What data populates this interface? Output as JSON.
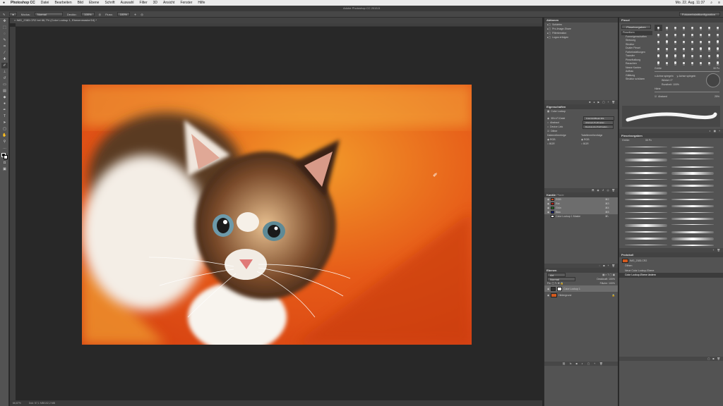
{
  "menubar": {
    "apple": "",
    "app": "Photoshop CC",
    "items": [
      "Datei",
      "Bearbeiten",
      "Bild",
      "Ebene",
      "Schrift",
      "Auswahl",
      "Filter",
      "3D",
      "Ansicht",
      "Fenster",
      "Hilfe"
    ],
    "clock": "Mo. 22. Aug. 11:37"
  },
  "window_title": "Adobe Photoshop CC 2015.5",
  "options": {
    "mode_label": "Modus:",
    "mode_value": "Normal",
    "opacity_label": "Deckkr.:",
    "opacity_value": "100%",
    "flow_label": "Fluss:",
    "flow_value": "100%",
    "workspace": "Fotowerkstattkonfiguration"
  },
  "document": {
    "tab": "IMG_2383.CR2 bei 66,7% (Color Lookup 1, Ebenenmaske/16) *",
    "status_zoom": "66,67%",
    "status_info": "Dok: 57,1 MB/102,2 MB"
  },
  "history_panel": {
    "title": "Aktionen",
    "items": [
      "Schärfen",
      "Pro-Image-Share",
      "Filterkreation",
      "Logos erfolgen"
    ]
  },
  "properties_panel": {
    "title": "Eigenschaften",
    "subtitle": "Color Lookup",
    "rows": [
      {
        "label": "3DLUT-Datei",
        "value": "FuturisticBleak.3DL"
      },
      {
        "label": "Abstract",
        "value": "Abstract-Profil laden..."
      },
      {
        "label": "Device Link",
        "value": "DeviceLink-Profil laden..."
      },
      {
        "label": "Dither",
        "value": ""
      }
    ],
    "data_order_label": "Datenreihenfolge",
    "table_order_label": "Tabellenreihenfolge",
    "rgb": "RGB",
    "bgr": "BGR"
  },
  "channels_panel": {
    "tabs": [
      "Kanäle",
      "Pfade"
    ],
    "items": [
      {
        "name": "RGB",
        "shortcut": "⌘2",
        "color": "#c84a1e"
      },
      {
        "name": "Rot",
        "shortcut": "⌘3",
        "color": "#b81c10"
      },
      {
        "name": "Grün",
        "shortcut": "⌘4",
        "color": "#1e6e1e"
      },
      {
        "name": "Blau",
        "shortcut": "⌘5",
        "color": "#101c70"
      },
      {
        "name": "Color Lookup 1 Maske",
        "shortcut": "⌘\\",
        "color": "#ffffff"
      }
    ]
  },
  "layers_panel": {
    "title": "Ebenen",
    "filter": "Art",
    "blend": "Normal",
    "opacity_label": "Deckkraft: 100%",
    "fill_label": "Fläche: 100%",
    "items": [
      {
        "name": "Color Lookup 1",
        "selected": true
      },
      {
        "name": "Hintergrund",
        "selected": false
      }
    ]
  },
  "brush_panel": {
    "title": "Pinsel",
    "presets_button": "Pinselvorgaben",
    "sizes": [
      "30",
      "30",
      "30",
      "25",
      "25",
      "36",
      "25",
      "25",
      "36",
      "36",
      "32",
      "25",
      "14",
      "24",
      "27",
      "39",
      "46",
      "59",
      "11",
      "17",
      "23",
      "36",
      "44",
      "60",
      "14",
      "26",
      "33",
      "42",
      "55",
      "70",
      "112",
      "134",
      "74",
      "95",
      "95",
      "90",
      "36",
      "36",
      "33",
      "63",
      "66",
      "39",
      "63",
      "11",
      "48",
      "32",
      "55",
      "100"
    ],
    "options": [
      "Pinselform",
      "Formeigenschaften",
      "Streuung",
      "Struktur",
      "Dualer Pinsel",
      "Farbeinstellungen",
      "Transfer",
      "Pinselhaltung",
      "Rauschen",
      "Nasse Kanten",
      "Aufbau",
      "Glättung",
      "Struktur schützen"
    ],
    "size_label": "Größe",
    "size_value": "30 Px",
    "flip_x": "x-Achse spiegeln",
    "flip_y": "y-Achse spiegeln",
    "angle": "Winkel: 0°",
    "roundness": "Rundheit: 100%",
    "hardness": "Härte",
    "spacing": "Abstand",
    "spacing_value": "25%"
  },
  "brush_presets": {
    "title": "Pinselvorgaben",
    "size_label": "Größe:",
    "size_value": "30 Px"
  },
  "history_list": {
    "title": "Protokoll",
    "snapshot": "IMG_2383.CR2",
    "items": [
      "Öffnen",
      "Neue Color Lookup-Ebene",
      "Color Lookup-Ebene ändern"
    ]
  },
  "tools": [
    "move-icon",
    "marquee-icon",
    "lasso-icon",
    "quick-select-icon",
    "crop-icon",
    "eyedropper-icon",
    "healing-icon",
    "brush-icon",
    "stamp-icon",
    "history-brush-icon",
    "eraser-icon",
    "gradient-icon",
    "blur-icon",
    "dodge-icon",
    "pen-icon",
    "type-icon",
    "path-select-icon",
    "shape-icon",
    "hand-icon",
    "zoom-icon"
  ]
}
